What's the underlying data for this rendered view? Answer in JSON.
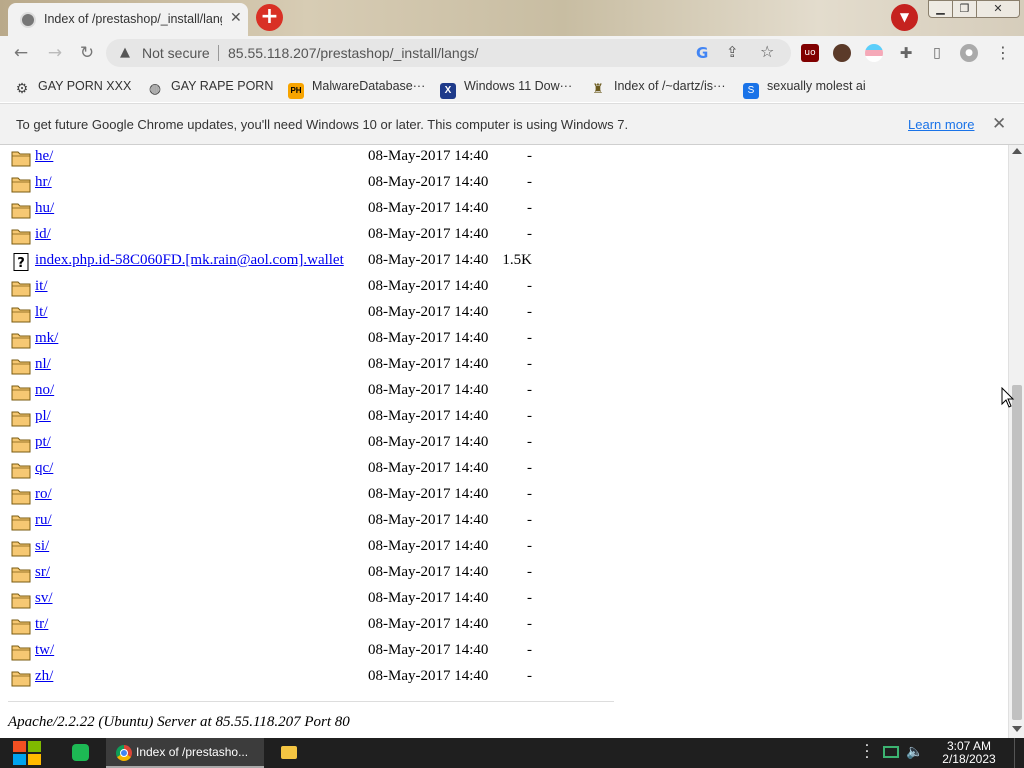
{
  "browser": {
    "tab_title": "Index of /prestashop/_install/langs/",
    "tab_close": "✕",
    "new_tab": "+",
    "security_label": "Not secure",
    "url": "85.55.118.207/prestashop/_install/langs/"
  },
  "bookmarks": [
    {
      "label": "GAY PORN XXX",
      "icon": "gear-icon"
    },
    {
      "label": "GAY RAPE PORN",
      "icon": "globe-icon"
    },
    {
      "label": "MalwareDatabase···",
      "icon": "ph-icon"
    },
    {
      "label": "Windows 11 Dow···",
      "icon": "x-icon"
    },
    {
      "label": "Index of /~dartz/is···",
      "icon": "index-icon"
    },
    {
      "label": "sexually molest ai",
      "icon": "doc-icon"
    }
  ],
  "infobar": {
    "message": "To get future Google Chrome updates, you'll need Windows 10 or later. This computer is using Windows 7.",
    "link": "Learn more"
  },
  "listing": {
    "entries": [
      {
        "name": "he/",
        "date": "08-May-2017 14:40",
        "size": "-",
        "type": "folder"
      },
      {
        "name": "hr/",
        "date": "08-May-2017 14:40",
        "size": "-",
        "type": "folder"
      },
      {
        "name": "hu/",
        "date": "08-May-2017 14:40",
        "size": "-",
        "type": "folder"
      },
      {
        "name": "id/",
        "date": "08-May-2017 14:40",
        "size": "-",
        "type": "folder"
      },
      {
        "name": "index.php.id-58C060FD.[mk.rain@aol.com].wallet",
        "date": "08-May-2017 14:40",
        "size": "1.5K",
        "type": "file"
      },
      {
        "name": "it/",
        "date": "08-May-2017 14:40",
        "size": "-",
        "type": "folder"
      },
      {
        "name": "lt/",
        "date": "08-May-2017 14:40",
        "size": "-",
        "type": "folder"
      },
      {
        "name": "mk/",
        "date": "08-May-2017 14:40",
        "size": "-",
        "type": "folder"
      },
      {
        "name": "nl/",
        "date": "08-May-2017 14:40",
        "size": "-",
        "type": "folder"
      },
      {
        "name": "no/",
        "date": "08-May-2017 14:40",
        "size": "-",
        "type": "folder"
      },
      {
        "name": "pl/",
        "date": "08-May-2017 14:40",
        "size": "-",
        "type": "folder"
      },
      {
        "name": "pt/",
        "date": "08-May-2017 14:40",
        "size": "-",
        "type": "folder"
      },
      {
        "name": "qc/",
        "date": "08-May-2017 14:40",
        "size": "-",
        "type": "folder"
      },
      {
        "name": "ro/",
        "date": "08-May-2017 14:40",
        "size": "-",
        "type": "folder"
      },
      {
        "name": "ru/",
        "date": "08-May-2017 14:40",
        "size": "-",
        "type": "folder"
      },
      {
        "name": "si/",
        "date": "08-May-2017 14:40",
        "size": "-",
        "type": "folder"
      },
      {
        "name": "sr/",
        "date": "08-May-2017 14:40",
        "size": "-",
        "type": "folder"
      },
      {
        "name": "sv/",
        "date": "08-May-2017 14:40",
        "size": "-",
        "type": "folder"
      },
      {
        "name": "tr/",
        "date": "08-May-2017 14:40",
        "size": "-",
        "type": "folder"
      },
      {
        "name": "tw/",
        "date": "08-May-2017 14:40",
        "size": "-",
        "type": "folder"
      },
      {
        "name": "zh/",
        "date": "08-May-2017 14:40",
        "size": "-",
        "type": "folder"
      }
    ],
    "footer": "Apache/2.2.22 (Ubuntu) Server at 85.55.118.207 Port 80"
  },
  "taskbar": {
    "chrome_label": "Index of /prestasho...",
    "time": "3:07 AM",
    "date": "2/18/2023"
  },
  "colors": {
    "link": "#0000ee",
    "folder_fill": "#f6c873",
    "folder_stroke": "#7a5b12",
    "chrome_accent": "#1a73e8"
  }
}
